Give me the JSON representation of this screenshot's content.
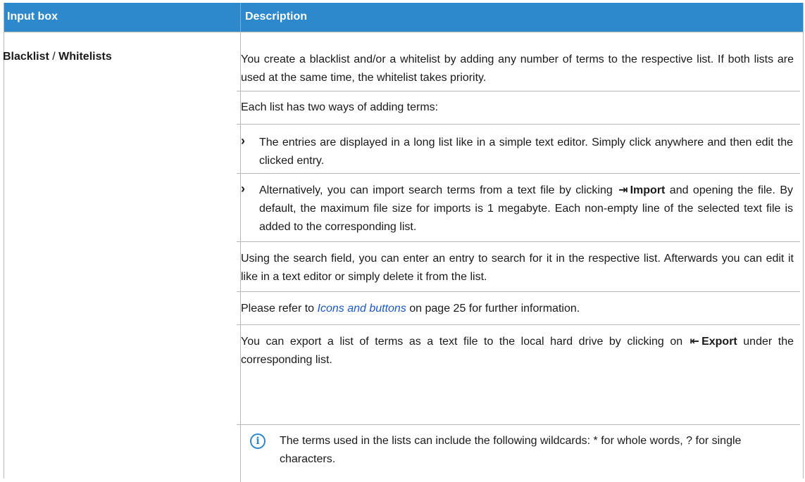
{
  "header": {
    "col1": "Input box",
    "col2": "Description"
  },
  "row": {
    "field_a": "Blacklist",
    "field_sep": " / ",
    "field_b": "Whitelists",
    "p1": "You create a blacklist and/or a whitelist by adding any number of terms to the respective list. If both lists are used at the same time, the whitelist takes priority.",
    "p2": "Each list has two ways of adding terms:",
    "bullet1": "The entries are displayed in a long list like in a simple text editor. Simply click anywhere and then edit the clicked entry.",
    "bullet2_pre": "Alternatively, you can import search terms from a text file by clicking ",
    "import_label": "Import",
    "bullet2_post": " and opening the file. By default, the maximum file size for imports is 1 megabyte. Each non-empty line of the selected text file is added to the corresponding list.",
    "p3": "Using the search field, you can enter an entry to search for it in the respective list. Afterwards you can edit it like in a text editor or simply delete it from the list.",
    "p4_pre": "Please refer to ",
    "p4_link": "Icons and buttons",
    "p4_post": " on page 25 for further information.",
    "p5_pre": "You can export a list of terms as a text file to the local hard drive by clicking on ",
    "export_label": "Export",
    "p5_post": " under the corresponding list.",
    "note": "The terms used in the lists can include the following wildcards: * for whole words, ? for single characters."
  },
  "icons": {
    "bullet": "chevron-right-icon",
    "import": "import-icon",
    "export": "export-icon",
    "info": "info-icon"
  },
  "colors": {
    "header_bg": "#2d89cc",
    "link": "#1a58c8"
  }
}
